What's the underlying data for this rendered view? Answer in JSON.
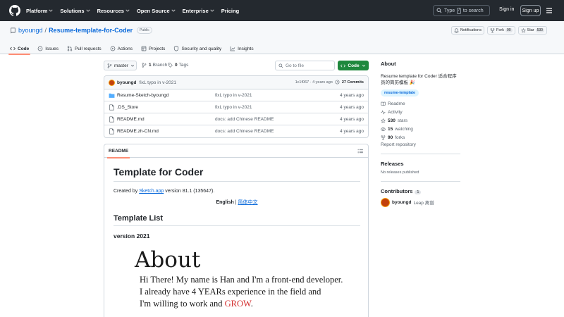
{
  "header": {
    "nav": [
      "Platform",
      "Solutions",
      "Resources",
      "Open Source",
      "Enterprise",
      "Pricing"
    ],
    "search_prefix": "Type",
    "search_key": "/",
    "search_suffix": "to search",
    "sign_in": "Sign in",
    "sign_up": "Sign up"
  },
  "repo": {
    "owner": "byoungd",
    "separator": "/",
    "name": "Resume-template-for-Coder",
    "visibility": "Public",
    "notifications_label": "Notifications",
    "fork_label": "Fork",
    "fork_count": "90",
    "star_label": "Star",
    "star_count": "530"
  },
  "tabs": [
    "Code",
    "Issues",
    "Pull requests",
    "Actions",
    "Projects",
    "Security and quality",
    "Insights"
  ],
  "toolbar": {
    "branch": "master",
    "branches": "1 Branch",
    "branches_count": "1",
    "branches_label": "Branch",
    "tags_count": "0",
    "tags_label": "Tags",
    "goto_placeholder": "Go to file",
    "code_label": "Code"
  },
  "latest_commit": {
    "author": "byoungd",
    "message": "fixL typo in v-2021",
    "sha_age": "1c1f067 · 4 years ago",
    "commit_count": "27 Commits"
  },
  "files": [
    {
      "name": "Resume-Sketch-byoungd",
      "type": "folder",
      "commit": "fixL typo in v-2021",
      "age": "4 years ago"
    },
    {
      "name": ".DS_Store",
      "type": "file",
      "commit": "fixL typo in v-2021",
      "age": "4 years ago"
    },
    {
      "name": "README.md",
      "type": "file",
      "commit": "docs: add Chinese README",
      "age": "4 years ago"
    },
    {
      "name": "README.zh-CN.md",
      "type": "file",
      "commit": "docs: add Chinese README",
      "age": "4 years ago"
    }
  ],
  "readme": {
    "tab": "README",
    "title": "Template for Coder",
    "created_prefix": "Created by",
    "created_link": "Sketch.app",
    "created_suffix": "version 81.1 (135647).",
    "lang_english": "English",
    "lang_sep": "|",
    "lang_chinese": "简体中文",
    "template_list": "Template List",
    "version": "version 2021",
    "about_heading": "About",
    "about_line1": "Hi There! My name is Han and I'm a front-end developer.",
    "about_line2": "I already have 4 YEARs experience in the field and",
    "about_line3_prefix": "I'm willing to work and",
    "about_line3_grow": "GROW",
    "about_line3_suffix": "."
  },
  "sidebar": {
    "about_title": "About",
    "description": "Resume template for Coder 适合程序员的简历模板 🎉",
    "topic": "resume-template",
    "readme": "Readme",
    "activity": "Activity",
    "stars_count": "530",
    "stars_label": "stars",
    "watching_count": "15",
    "watching_label": "watching",
    "forks_count": "90",
    "forks_label": "forks",
    "report": "Report repository",
    "releases_title": "Releases",
    "no_releases": "No releases published",
    "contributors_title": "Contributors",
    "contributors_count": "1",
    "contributor_login": "byoungd",
    "contributor_name": "Leap 离谱"
  },
  "colors": {
    "header_bg": "#24292f",
    "link": "#0969da",
    "green_button": "#1f883d",
    "tab_underline": "#fd8c73",
    "grow_red": "#d32f2f"
  }
}
